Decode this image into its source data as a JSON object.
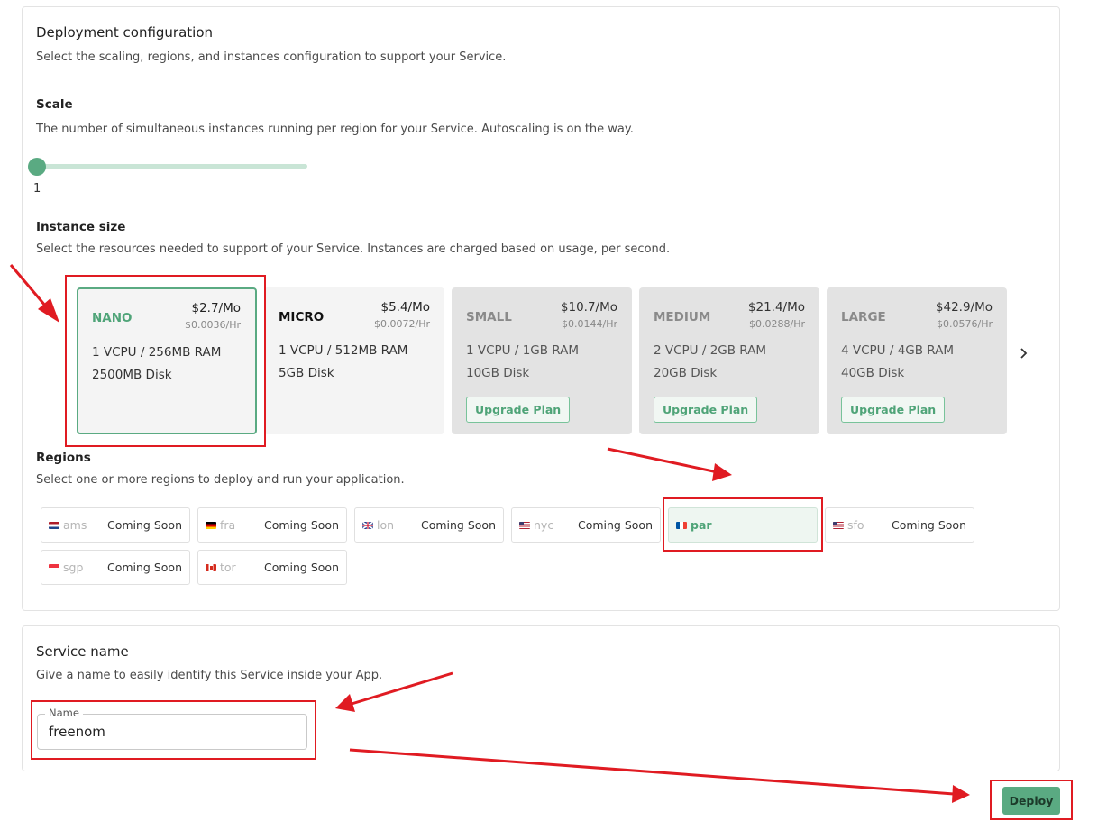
{
  "deployment": {
    "title": "Deployment configuration",
    "description": "Select the scaling, regions, and instances configuration to support your Service."
  },
  "scale": {
    "title": "Scale",
    "description": "The number of simultaneous instances running per region for your Service. Autoscaling is on the way.",
    "value": "1",
    "level_fraction": 0
  },
  "instance_size": {
    "title": "Instance size",
    "description": "Select the resources needed to support of your Service. Instances are charged based on usage, per second.",
    "upgrade_label": "Upgrade Plan",
    "items": [
      {
        "name": "NANO",
        "price_mo": "$2.7/Mo",
        "price_hr": "$0.0036/Hr",
        "line1": "1 VCPU / 256MB RAM",
        "line2": "2500MB Disk",
        "state": "selected"
      },
      {
        "name": "MICRO",
        "price_mo": "$5.4/Mo",
        "price_hr": "$0.0072/Hr",
        "line1": "1 VCPU / 512MB RAM",
        "line2": "5GB Disk",
        "state": "available"
      },
      {
        "name": "SMALL",
        "price_mo": "$10.7/Mo",
        "price_hr": "$0.0144/Hr",
        "line1": "1 VCPU / 1GB RAM",
        "line2": "10GB Disk",
        "state": "upgrade"
      },
      {
        "name": "MEDIUM",
        "price_mo": "$21.4/Mo",
        "price_hr": "$0.0288/Hr",
        "line1": "2 VCPU / 2GB RAM",
        "line2": "20GB Disk",
        "state": "upgrade"
      },
      {
        "name": "LARGE",
        "price_mo": "$42.9/Mo",
        "price_hr": "$0.0576/Hr",
        "line1": "4 VCPU / 4GB RAM",
        "line2": "40GB Disk",
        "state": "upgrade"
      }
    ],
    "next_icon": "chevron-right-icon"
  },
  "regions": {
    "title": "Regions",
    "description": "Select one or more regions to deploy and run your application.",
    "coming_soon_label": "Coming Soon",
    "items": [
      {
        "code": "ams",
        "flag": "netherlands",
        "status": "Coming Soon"
      },
      {
        "code": "fra",
        "flag": "germany",
        "status": "Coming Soon"
      },
      {
        "code": "lon",
        "flag": "united-kingdom",
        "status": "Coming Soon"
      },
      {
        "code": "nyc",
        "flag": "united-states",
        "status": "Coming Soon"
      },
      {
        "code": "par",
        "flag": "france",
        "status": "",
        "selected": true
      },
      {
        "code": "sfo",
        "flag": "united-states",
        "status": "Coming Soon"
      },
      {
        "code": "sgp",
        "flag": "singapore",
        "status": "Coming Soon"
      },
      {
        "code": "tor",
        "flag": "canada",
        "status": "Coming Soon"
      }
    ]
  },
  "service_name": {
    "title": "Service name",
    "description": "Give a name to easily identify this Service inside your App.",
    "field_label": "Name",
    "field_value": "freenom"
  },
  "deploy": {
    "label": "Deploy"
  },
  "colors": {
    "accent": "#5aaa82",
    "accent_text": "#4fa478",
    "annotation": "#e01b22"
  }
}
